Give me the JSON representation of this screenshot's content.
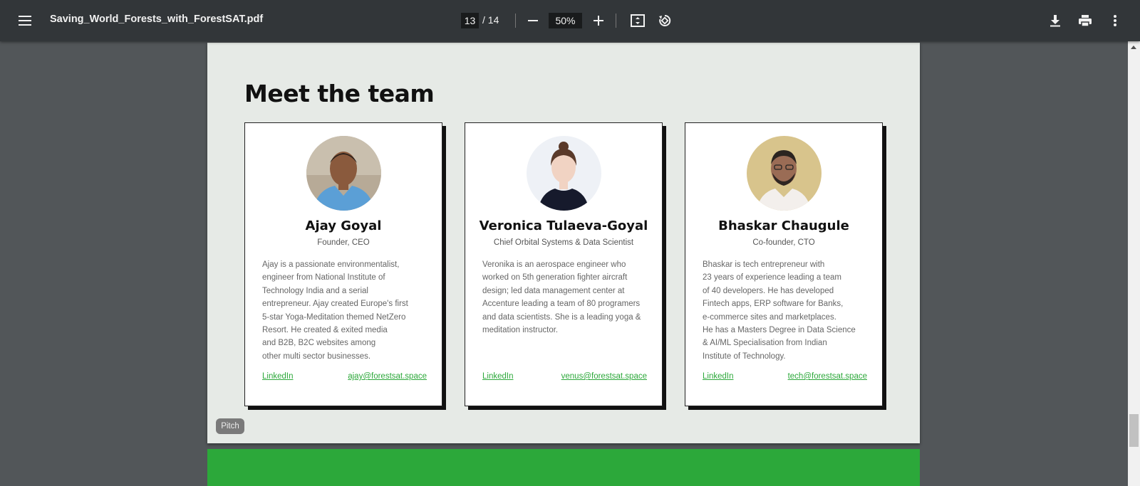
{
  "toolbar": {
    "filename": "Saving_World_Forests_with_ForestSAT.pdf",
    "current_page": "13",
    "total_pages": "/ 14",
    "zoom": "50%",
    "icons": [
      "menu-icon",
      "zoom-out-icon",
      "zoom-in-icon",
      "fit-page-icon",
      "rotate-icon",
      "download-icon",
      "print-icon",
      "more-icon"
    ]
  },
  "page": {
    "heading": "Meet the team",
    "tag": "Pitch",
    "background": "#e6eae6",
    "next_page_color": "#2ca83a",
    "team": [
      {
        "name": "Ajay Goyal",
        "role": "Founder, CEO",
        "bio": [
          "Ajay is a passionate environmentalist,",
          "engineer from National Institute of",
          "Technology India and a serial",
          "entrepreneur. Ajay created Europe's first",
          "5-star Yoga-Meditation themed NetZero",
          "Resort. He created & exited media",
          "and B2B, B2C websites among",
          "other multi sector businesses."
        ],
        "link": "LinkedIn",
        "email": "ajay@forestsat.space"
      },
      {
        "name": "Veronica Tulaeva-Goyal",
        "role": "Chief Orbital Systems & Data Scientist",
        "bio": [
          "Veronika is an aerospace engineer who",
          "worked on 5th generation fighter aircraft",
          "design; led data management center at",
          "Accenture leading a team of 80 programers",
          "and data scientists. She is a leading yoga &",
          "meditation instructor."
        ],
        "link": "LinkedIn",
        "email": "venus@forestsat.space"
      },
      {
        "name": "Bhaskar Chaugule",
        "role": "Co-founder, CTO",
        "bio": [
          "Bhaskar is tech entrepreneur with",
          "23 years of experience leading a team",
          "of 40 developers. He has developed",
          "Fintech apps, ERP software for Banks,",
          "e-commerce sites and marketplaces.",
          "He has a Masters Degree in Data Science",
          "& AI/ML Specialisation from Indian",
          "Institute of Technology."
        ],
        "link": "LinkedIn",
        "email": "tech@forestsat.space"
      }
    ]
  },
  "colors": {
    "toolbar": "#323639",
    "viewer_bg": "#525659",
    "link": "#2ca83a"
  }
}
